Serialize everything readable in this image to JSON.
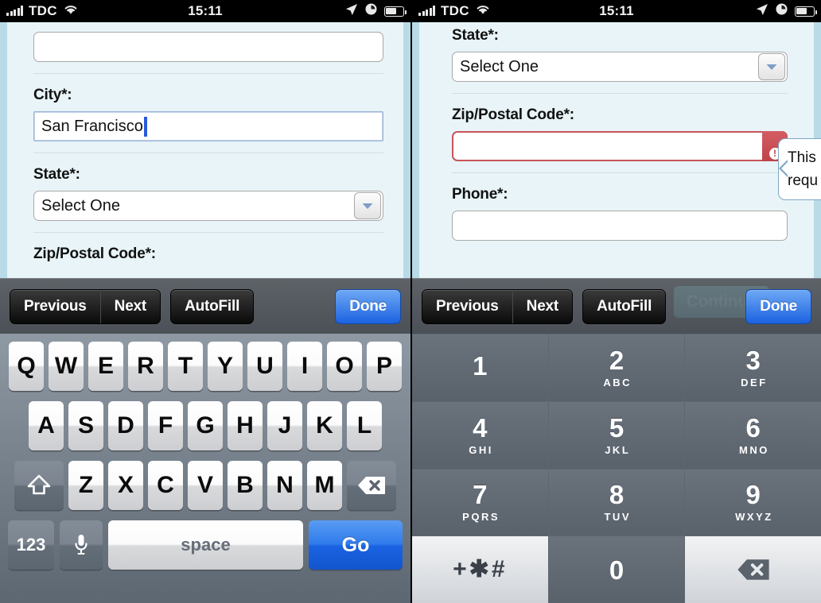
{
  "status_bar": {
    "carrier": "TDC",
    "time": "15:11",
    "icons": [
      "signal-bars-icon",
      "wifi-icon",
      "location-arrow-icon",
      "alarm-clock-icon",
      "battery-icon"
    ]
  },
  "left_phone": {
    "form": {
      "top_field": {
        "label": "",
        "value": ""
      },
      "city": {
        "label": "City*:",
        "value": "San Francisco",
        "focused": true
      },
      "state": {
        "label": "State*:",
        "value": "Select One"
      },
      "zip_partial": {
        "label": "Zip/Postal Code*:"
      }
    },
    "accessory_toolbar": {
      "previous": "Previous",
      "next": "Next",
      "autofill": "AutoFill",
      "done": "Done"
    },
    "keyboard": {
      "type": "qwerty",
      "row1": [
        "Q",
        "W",
        "E",
        "R",
        "T",
        "Y",
        "U",
        "I",
        "O",
        "P"
      ],
      "row2": [
        "A",
        "S",
        "D",
        "F",
        "G",
        "H",
        "J",
        "K",
        "L"
      ],
      "row3": [
        "Z",
        "X",
        "C",
        "V",
        "B",
        "N",
        "M"
      ],
      "shift": "shift-icon",
      "backspace": "backspace-icon",
      "numbers": "123",
      "dictation": "microphone-icon",
      "space": "space",
      "go": "Go"
    }
  },
  "right_phone": {
    "form": {
      "state": {
        "label": "State*:",
        "value": "Select One"
      },
      "zip": {
        "label": "Zip/Postal Code*:",
        "value": "",
        "error": true
      },
      "phone": {
        "label": "Phone*:",
        "value": ""
      }
    },
    "tooltip": {
      "text": "This is requ"
    },
    "continue_button": "Continue",
    "accessory_toolbar": {
      "previous": "Previous",
      "next": "Next",
      "autofill": "AutoFill",
      "done": "Done"
    },
    "keypad": {
      "type": "numeric",
      "keys": [
        {
          "digit": "1",
          "letters": ""
        },
        {
          "digit": "2",
          "letters": "ABC"
        },
        {
          "digit": "3",
          "letters": "DEF"
        },
        {
          "digit": "4",
          "letters": "GHI"
        },
        {
          "digit": "5",
          "letters": "JKL"
        },
        {
          "digit": "6",
          "letters": "MNO"
        },
        {
          "digit": "7",
          "letters": "PQRS"
        },
        {
          "digit": "8",
          "letters": "TUV"
        },
        {
          "digit": "9",
          "letters": "WXYZ"
        }
      ],
      "symbols": "+✱#",
      "zero": "0",
      "backspace": "backspace-icon"
    }
  },
  "colors": {
    "form_bg": "#e8f4f7",
    "page_edge": "#b9dbe8",
    "error_red": "#c0434b",
    "done_blue": "#1b62e0",
    "go_blue": "#1a63e2",
    "continue_teal": "#2c6a72",
    "keyboard_bg": "#5d6772",
    "numpad_key": "#646d77"
  }
}
